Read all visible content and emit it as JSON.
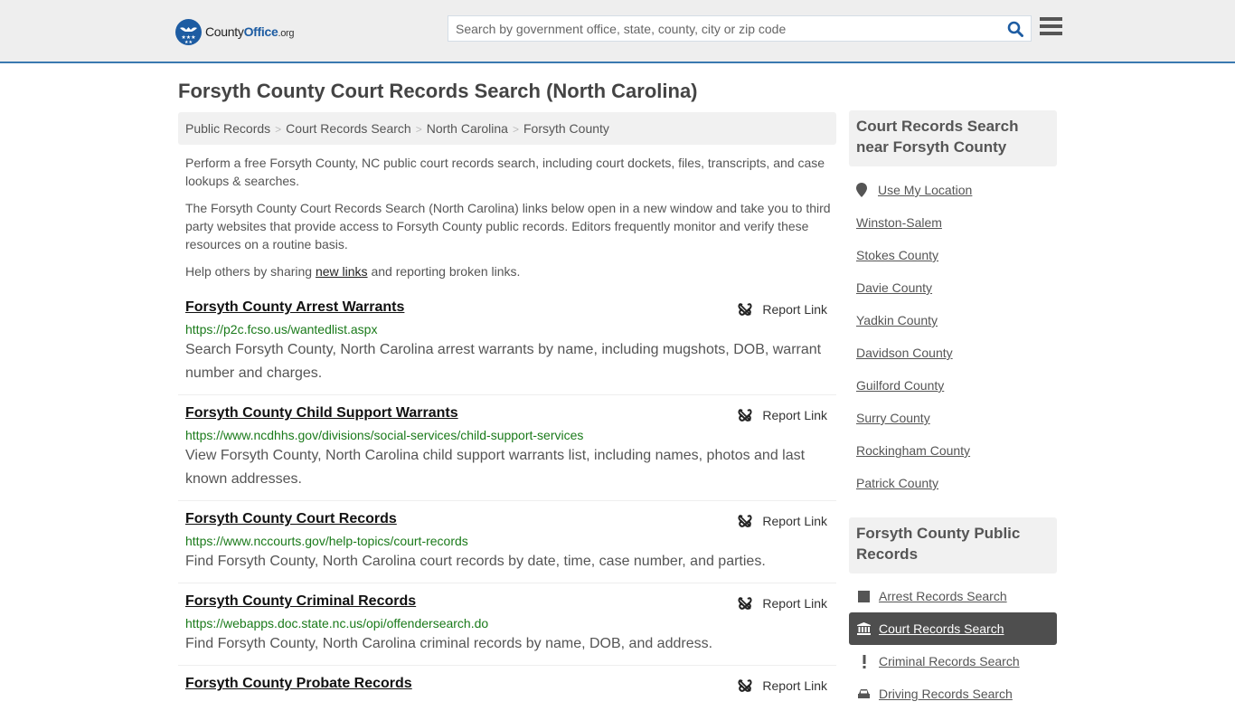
{
  "header": {
    "logo": {
      "county": "County",
      "office": "Office",
      "org": ".org"
    },
    "search_placeholder": "Search by government office, state, county, city or zip code",
    "search_value": "",
    "icons": {
      "search": "search-icon",
      "menu": "hamburger-menu-icon"
    }
  },
  "page_title": "Forsyth County Court Records Search (North Carolina)",
  "breadcrumb": [
    "Public Records",
    "Court Records Search",
    "North Carolina",
    "Forsyth County"
  ],
  "intro": {
    "p1": "Perform a free Forsyth County, NC public court records search, including court dockets, files, transcripts, and case lookups & searches.",
    "p2": "The Forsyth County Court Records Search (North Carolina) links below open in a new window and take you to third party websites that provide access to Forsyth County public records. Editors frequently monitor and verify these resources on a routine basis.",
    "p3_before": "Help others by sharing ",
    "p3_link": "new links",
    "p3_after": " and reporting broken links."
  },
  "report_label": "Report Link",
  "results": [
    {
      "title": "Forsyth County Arrest Warrants",
      "url": "https://p2c.fcso.us/wantedlist.aspx",
      "desc": "Search Forsyth County, North Carolina arrest warrants by name, including mugshots, DOB, warrant number and charges."
    },
    {
      "title": "Forsyth County Child Support Warrants",
      "url": "https://www.ncdhhs.gov/divisions/social-services/child-support-services",
      "desc": "View Forsyth County, North Carolina child support warrants list, including names, photos and last known addresses."
    },
    {
      "title": "Forsyth County Court Records",
      "url": "https://www.nccourts.gov/help-topics/court-records",
      "desc": "Find Forsyth County, North Carolina court records by date, time, case number, and parties."
    },
    {
      "title": "Forsyth County Criminal Records",
      "url": "https://webapps.doc.state.nc.us/opi/offendersearch.do",
      "desc": "Find Forsyth County, North Carolina criminal records by name, DOB, and address."
    },
    {
      "title": "Forsyth County Probate Records",
      "url": "",
      "desc": ""
    }
  ],
  "sidebar": {
    "nearby_heading": "Court Records Search near Forsyth County",
    "use_location": "Use My Location",
    "nearby": [
      "Winston-Salem",
      "Stokes County",
      "Davie County",
      "Yadkin County",
      "Davidson County",
      "Guilford County",
      "Surry County",
      "Rockingham County",
      "Patrick County"
    ],
    "public_heading": "Forsyth County Public Records",
    "public_items": [
      {
        "label": "Arrest Records Search",
        "icon": "square-icon",
        "active": false
      },
      {
        "label": "Court Records Search",
        "icon": "courthouse-icon",
        "active": true
      },
      {
        "label": "Criminal Records Search",
        "icon": "exclamation-icon",
        "active": false
      },
      {
        "label": "Driving Records Search",
        "icon": "car-icon",
        "active": false
      }
    ]
  },
  "colors": {
    "accent": "#3a79b0",
    "brand_blue": "#1d5ca2",
    "url_green": "#1a7a1a",
    "active_bg": "#4e4e4e"
  }
}
